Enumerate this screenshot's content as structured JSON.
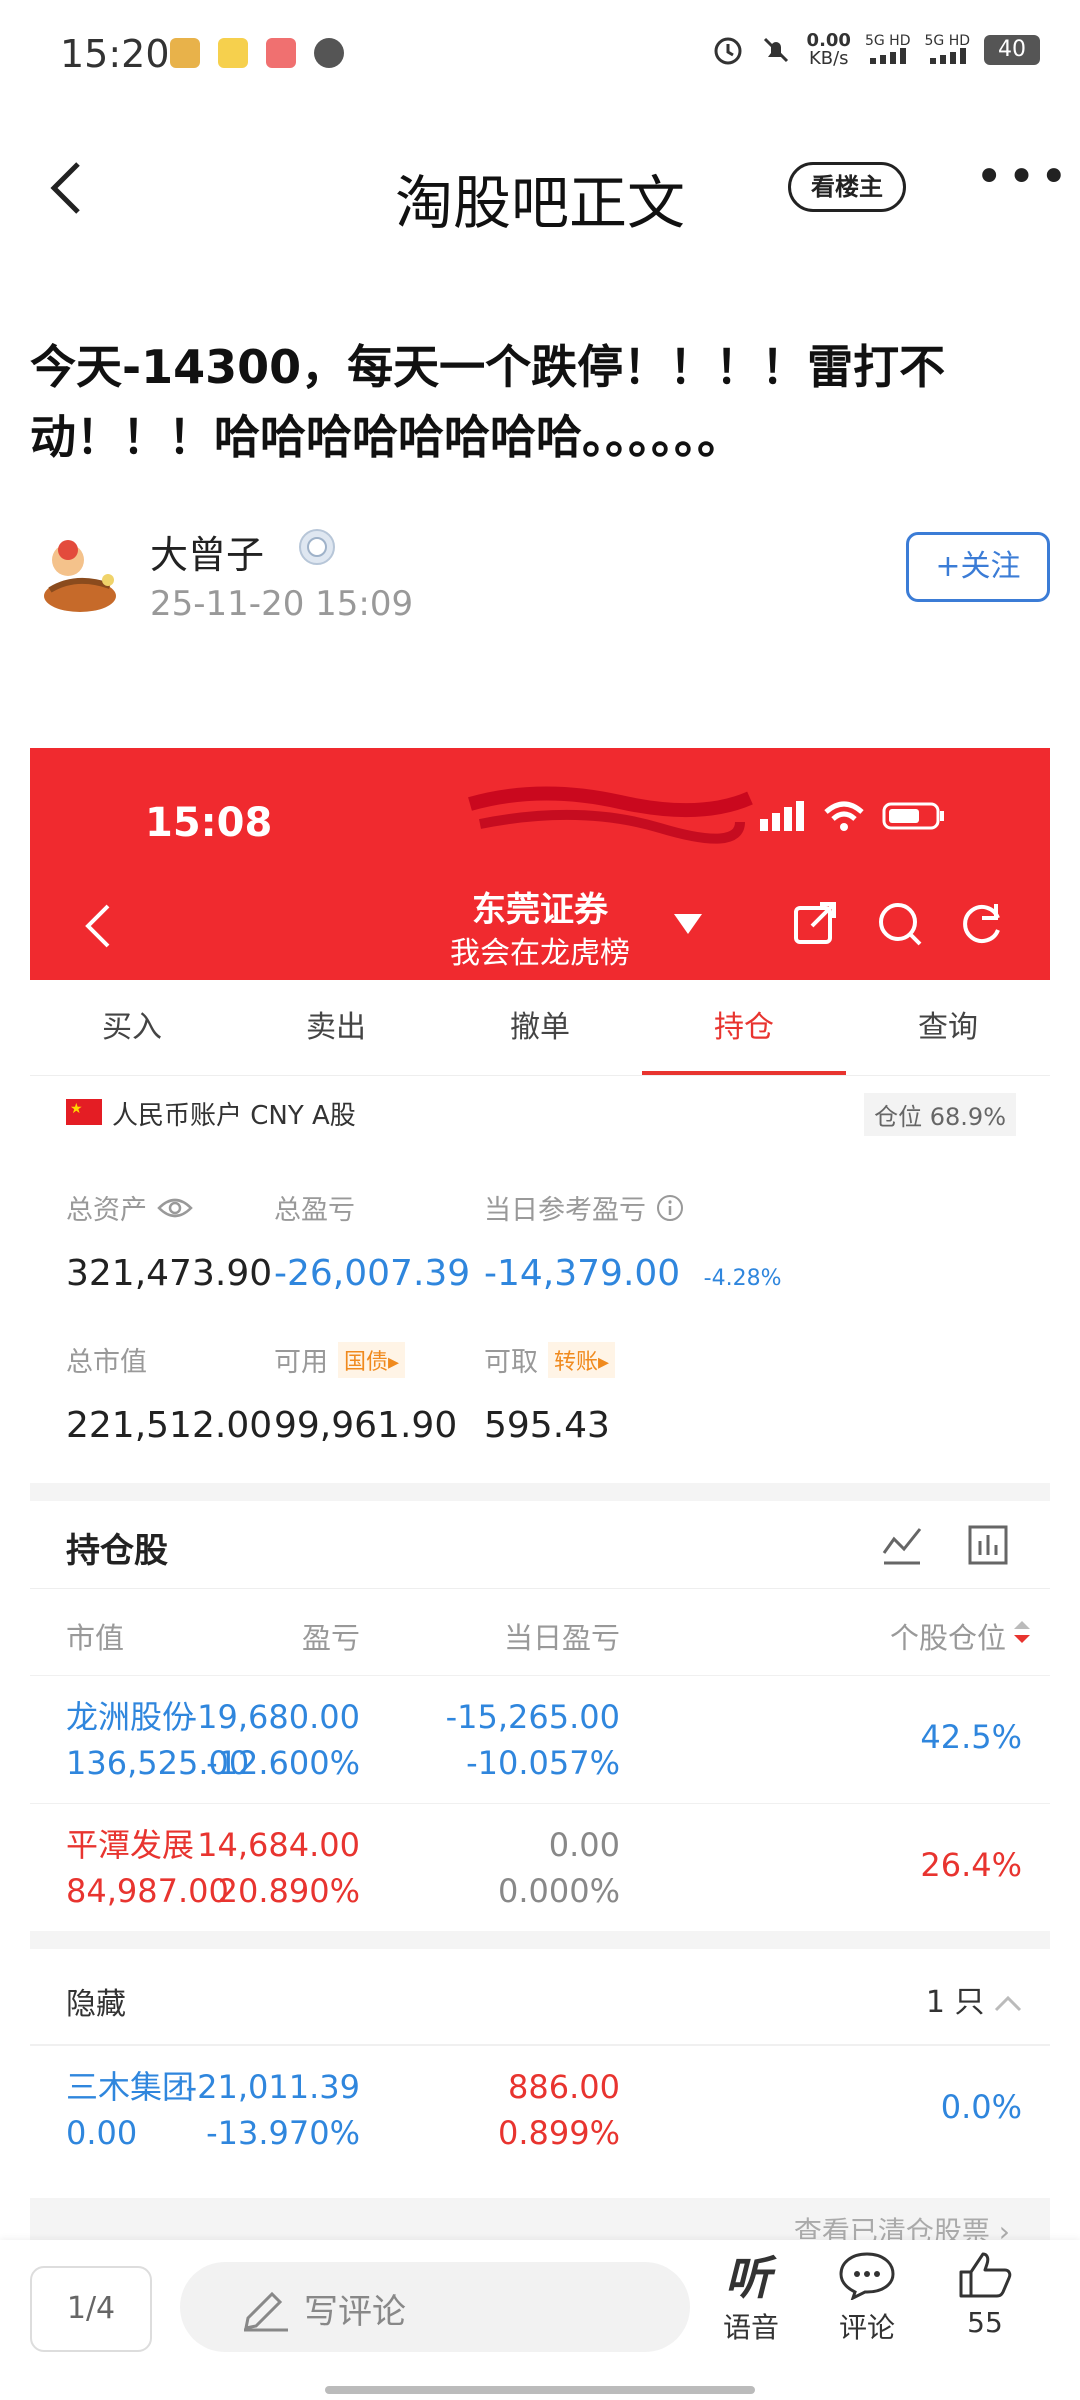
{
  "status": {
    "time": "15:20",
    "speed_value": "0.00",
    "speed_unit": "KB/s",
    "signal1": "5G HD",
    "signal2": "5G HD",
    "battery": "40"
  },
  "nav": {
    "title": "淘股吧正文",
    "owner_button": "看楼主",
    "more": "•••"
  },
  "post": {
    "title": "今天-14300，每天一个跌停！！！！雷打不动！！！哈哈哈哈哈哈哈哈。。。。。。",
    "author": "大曾子",
    "date": "25-11-20 15:09",
    "follow_label": "+关注"
  },
  "screenshot": {
    "time": "15:08",
    "broker": "东莞证券",
    "broker_sub": "我会在龙虎榜",
    "tabs": [
      "买入",
      "卖出",
      "撤单",
      "持仓",
      "查询"
    ],
    "active_tab": 3,
    "account": {
      "label": "人民币账户 CNY A股",
      "position_label": "仓位",
      "position_value": "68.9%"
    },
    "summary": {
      "total_assets_label": "总资产",
      "total_assets": "321,473.90",
      "total_pl_label": "总盈亏",
      "total_pl": "-26,007.39",
      "day_pl_label": "当日参考盈亏",
      "day_pl": "-14,379.00",
      "day_pl_pct": "-4.28%",
      "market_value_label": "总市值",
      "market_value": "221,512.00",
      "available_label": "可用",
      "available_tag": "国债▸",
      "available": "99,961.90",
      "withdrawable_label": "可取",
      "withdrawable_tag": "转账▸",
      "withdrawable": "595.43"
    },
    "holdings": {
      "title": "持仓股",
      "columns": [
        "市值",
        "盈亏",
        "当日盈亏",
        "个股仓位"
      ],
      "rows": [
        {
          "name": "龙洲股份",
          "mv": "136,525.00",
          "pl": "-19,680.00",
          "pl_pct": "-12.600%",
          "day": "-15,265.00",
          "day_pct": "-10.057%",
          "pos": "42.5%",
          "color": "#2f86dd"
        },
        {
          "name": "平潭发展",
          "mv": "84,987.00",
          "pl": "14,684.00",
          "pl_pct": "20.890%",
          "day": "0.00",
          "day_pct": "0.000%",
          "pos": "26.4%",
          "color": "#e8342f"
        }
      ]
    },
    "hidden": {
      "title": "隐藏",
      "count": "1 只",
      "rows": [
        {
          "name": "三木集团",
          "mv": "0.00",
          "pl": "-21,011.39",
          "pl_pct": "-13.970%",
          "day": "886.00",
          "day_pct": "0.899%",
          "pos": "0.0%"
        }
      ]
    },
    "cleared_label": "查看已清仓股票 ›"
  },
  "bottom": {
    "page": "1/4",
    "comment_placeholder": "写评论",
    "listen_label": "语音",
    "comment_label": "评论",
    "like_count": "55"
  }
}
